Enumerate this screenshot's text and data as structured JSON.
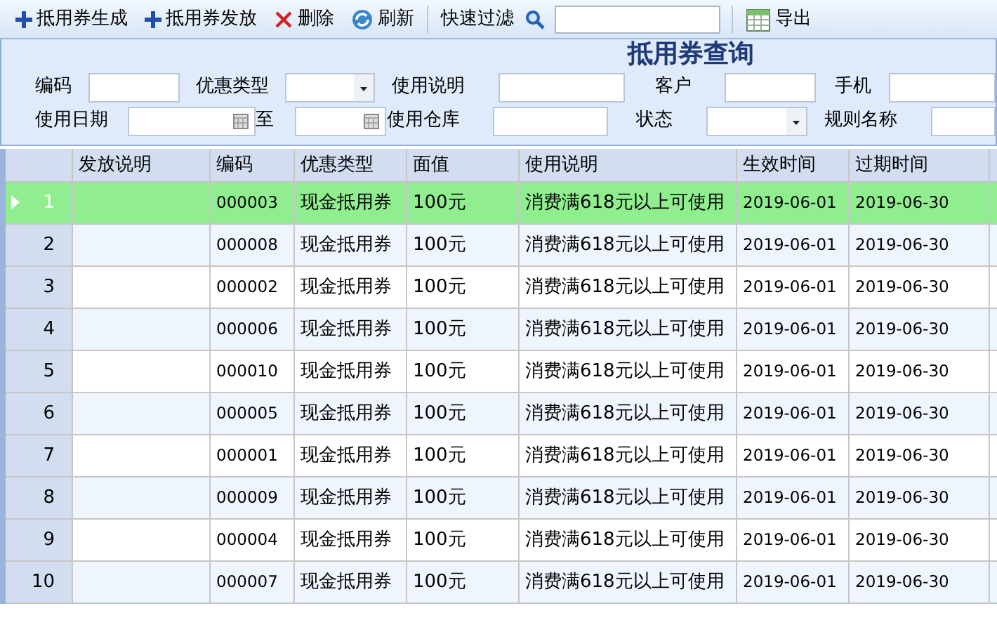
{
  "toolbar": [
    {
      "kind": "plus",
      "label": "抵用券生成"
    },
    {
      "kind": "plus",
      "label": "抵用券发放"
    },
    {
      "kind": "delete",
      "label": "删除"
    },
    {
      "kind": "refresh",
      "label": "刷新"
    },
    {
      "kind": "filter",
      "label": "快速过滤"
    },
    {
      "kind": "export",
      "label": "导出"
    }
  ],
  "panel": {
    "title": "抵用券查询",
    "rows": [
      [
        {
          "label": "编码",
          "kind": "text"
        },
        {
          "label": "优惠类型",
          "kind": "select"
        },
        {
          "label": "使用说明",
          "kind": "text"
        },
        {
          "label": "客户",
          "kind": "text"
        },
        {
          "label": "手机",
          "kind": "text"
        }
      ],
      [
        {
          "label": "使用日期",
          "kind": "date"
        },
        {
          "label": "至",
          "kind": "date"
        },
        {
          "label": "使用仓库",
          "kind": "text"
        },
        {
          "label": "状态",
          "kind": "select"
        },
        {
          "label": "规则名称",
          "kind": "text"
        }
      ]
    ]
  },
  "table": {
    "columns": [
      "发放说明",
      "编码",
      "优惠类型",
      "面值",
      "使用说明",
      "生效时间",
      "过期时间"
    ],
    "rows": [
      {
        "number": "1",
        "selected": true,
        "cells": [
          "",
          "000003",
          "现金抵用券",
          "100元",
          "消费满618元以上可使用",
          "2019-06-01",
          "2019-06-30"
        ]
      },
      {
        "number": "2",
        "selected": false,
        "cells": [
          "",
          "000008",
          "现金抵用券",
          "100元",
          "消费满618元以上可使用",
          "2019-06-01",
          "2019-06-30"
        ]
      },
      {
        "number": "3",
        "selected": false,
        "cells": [
          "",
          "000002",
          "现金抵用券",
          "100元",
          "消费满618元以上可使用",
          "2019-06-01",
          "2019-06-30"
        ]
      },
      {
        "number": "4",
        "selected": false,
        "cells": [
          "",
          "000006",
          "现金抵用券",
          "100元",
          "消费满618元以上可使用",
          "2019-06-01",
          "2019-06-30"
        ]
      },
      {
        "number": "5",
        "selected": false,
        "cells": [
          "",
          "000010",
          "现金抵用券",
          "100元",
          "消费满618元以上可使用",
          "2019-06-01",
          "2019-06-30"
        ]
      },
      {
        "number": "6",
        "selected": false,
        "cells": [
          "",
          "000005",
          "现金抵用券",
          "100元",
          "消费满618元以上可使用",
          "2019-06-01",
          "2019-06-30"
        ]
      },
      {
        "number": "7",
        "selected": false,
        "cells": [
          "",
          "000001",
          "现金抵用券",
          "100元",
          "消费满618元以上可使用",
          "2019-06-01",
          "2019-06-30"
        ]
      },
      {
        "number": "8",
        "selected": false,
        "cells": [
          "",
          "000009",
          "现金抵用券",
          "100元",
          "消费满618元以上可使用",
          "2019-06-01",
          "2019-06-30"
        ]
      },
      {
        "number": "9",
        "selected": false,
        "cells": [
          "",
          "000004",
          "现金抵用券",
          "100元",
          "消费满618元以上可使用",
          "2019-06-01",
          "2019-06-30"
        ]
      },
      {
        "number": "10",
        "selected": false,
        "cells": [
          "",
          "000007",
          "现金抵用券",
          "100元",
          "消费满618元以上可使用",
          "2019-06-01",
          "2019-06-30"
        ]
      }
    ]
  }
}
